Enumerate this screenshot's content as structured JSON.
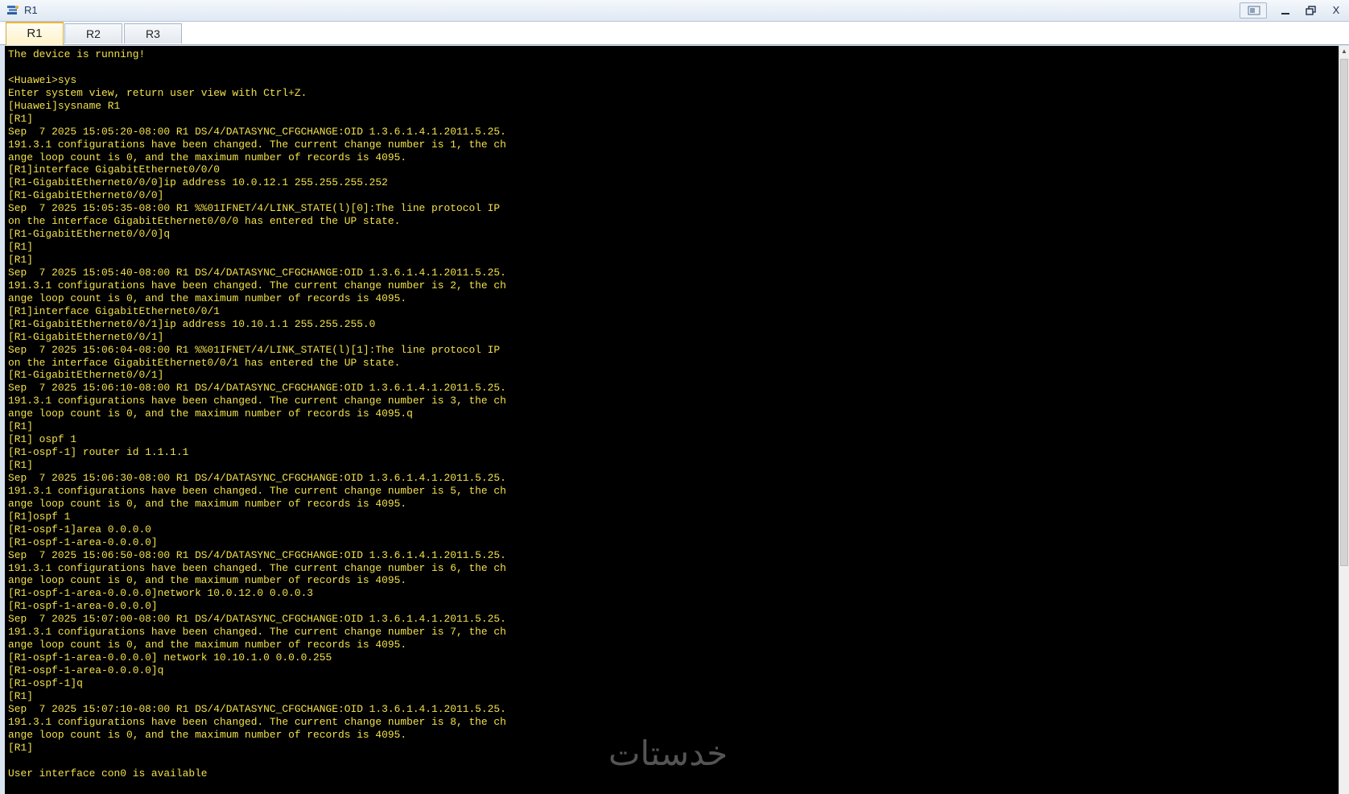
{
  "window": {
    "title": "R1",
    "controls": {
      "minimize_icon": "minimize-icon",
      "maximize_icon": "restore-icon",
      "close_label": "X"
    }
  },
  "tabs": [
    {
      "label": "R1",
      "active": true
    },
    {
      "label": "R2",
      "active": false
    },
    {
      "label": "R3",
      "active": false
    }
  ],
  "console": {
    "text_color": "#f2e04a",
    "background": "#000000",
    "lines": [
      "The device is running!",
      "",
      "<Huawei>sys",
      "Enter system view, return user view with Ctrl+Z.",
      "[Huawei]sysname R1",
      "[R1]",
      "Sep  7 2025 15:05:20-08:00 R1 DS/4/DATASYNC_CFGCHANGE:OID 1.3.6.1.4.1.2011.5.25.",
      "191.3.1 configurations have been changed. The current change number is 1, the ch",
      "ange loop count is 0, and the maximum number of records is 4095.",
      "[R1]interface GigabitEthernet0/0/0",
      "[R1-GigabitEthernet0/0/0]ip address 10.0.12.1 255.255.255.252",
      "[R1-GigabitEthernet0/0/0]",
      "Sep  7 2025 15:05:35-08:00 R1 %%01IFNET/4/LINK_STATE(l)[0]:The line protocol IP",
      "on the interface GigabitEthernet0/0/0 has entered the UP state.",
      "[R1-GigabitEthernet0/0/0]q",
      "[R1]",
      "[R1]",
      "Sep  7 2025 15:05:40-08:00 R1 DS/4/DATASYNC_CFGCHANGE:OID 1.3.6.1.4.1.2011.5.25.",
      "191.3.1 configurations have been changed. The current change number is 2, the ch",
      "ange loop count is 0, and the maximum number of records is 4095.",
      "[R1]interface GigabitEthernet0/0/1",
      "[R1-GigabitEthernet0/0/1]ip address 10.10.1.1 255.255.255.0",
      "[R1-GigabitEthernet0/0/1]",
      "Sep  7 2025 15:06:04-08:00 R1 %%01IFNET/4/LINK_STATE(l)[1]:The line protocol IP",
      "on the interface GigabitEthernet0/0/1 has entered the UP state.",
      "[R1-GigabitEthernet0/0/1]",
      "Sep  7 2025 15:06:10-08:00 R1 DS/4/DATASYNC_CFGCHANGE:OID 1.3.6.1.4.1.2011.5.25.",
      "191.3.1 configurations have been changed. The current change number is 3, the ch",
      "ange loop count is 0, and the maximum number of records is 4095.q",
      "[R1]",
      "[R1] ospf 1",
      "[R1-ospf-1] router id 1.1.1.1",
      "[R1]",
      "Sep  7 2025 15:06:30-08:00 R1 DS/4/DATASYNC_CFGCHANGE:OID 1.3.6.1.4.1.2011.5.25.",
      "191.3.1 configurations have been changed. The current change number is 5, the ch",
      "ange loop count is 0, and the maximum number of records is 4095.",
      "[R1]ospf 1",
      "[R1-ospf-1]area 0.0.0.0",
      "[R1-ospf-1-area-0.0.0.0]",
      "Sep  7 2025 15:06:50-08:00 R1 DS/4/DATASYNC_CFGCHANGE:OID 1.3.6.1.4.1.2011.5.25.",
      "191.3.1 configurations have been changed. The current change number is 6, the ch",
      "ange loop count is 0, and the maximum number of records is 4095.",
      "[R1-ospf-1-area-0.0.0.0]network 10.0.12.0 0.0.0.3",
      "[R1-ospf-1-area-0.0.0.0]",
      "Sep  7 2025 15:07:00-08:00 R1 DS/4/DATASYNC_CFGCHANGE:OID 1.3.6.1.4.1.2011.5.25.",
      "191.3.1 configurations have been changed. The current change number is 7, the ch",
      "ange loop count is 0, and the maximum number of records is 4095.",
      "[R1-ospf-1-area-0.0.0.0] network 10.10.1.0 0.0.0.255",
      "[R1-ospf-1-area-0.0.0.0]q",
      "[R1-ospf-1]q",
      "[R1]",
      "Sep  7 2025 15:07:10-08:00 R1 DS/4/DATASYNC_CFGCHANGE:OID 1.3.6.1.4.1.2011.5.25.",
      "191.3.1 configurations have been changed. The current change number is 8, the ch",
      "ange loop count is 0, and the maximum number of records is 4095.",
      "[R1]",
      "",
      "User interface con0 is available"
    ]
  },
  "watermark": {
    "text": "خدستات",
    "color": "#9a9a9a"
  },
  "colors": {
    "titlebar": "#e6eef7",
    "tab_active_accent": "#f2b43a",
    "console_text": "#f2e04a"
  }
}
